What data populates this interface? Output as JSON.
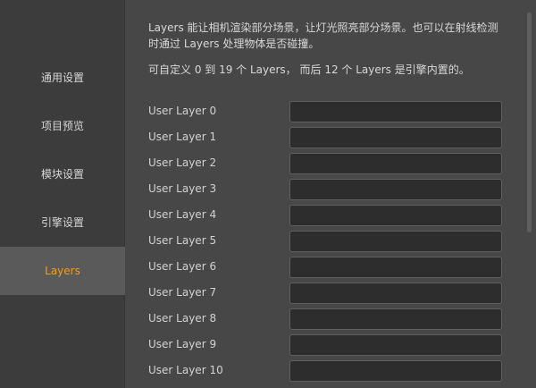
{
  "sidebar": {
    "items": [
      {
        "label": "通用设置",
        "active": false
      },
      {
        "label": "项目预览",
        "active": false
      },
      {
        "label": "模块设置",
        "active": false
      },
      {
        "label": "引擎设置",
        "active": false
      },
      {
        "label": "Layers",
        "active": true
      }
    ]
  },
  "main": {
    "description_line1": "Layers 能让相机渲染部分场景，让灯光照亮部分场景。也可以在射线检测",
    "description_line2": "时通过 Layers 处理物体是否碰撞。",
    "description_line3": "可自定义 0 到 19 个 Layers， 而后 12 个 Layers 是引擎内置的。",
    "layers": [
      {
        "label": "User Layer 0",
        "value": ""
      },
      {
        "label": "User Layer 1",
        "value": ""
      },
      {
        "label": "User Layer 2",
        "value": ""
      },
      {
        "label": "User Layer 3",
        "value": ""
      },
      {
        "label": "User Layer 4",
        "value": ""
      },
      {
        "label": "User Layer 5",
        "value": ""
      },
      {
        "label": "User Layer 6",
        "value": ""
      },
      {
        "label": "User Layer 7",
        "value": ""
      },
      {
        "label": "User Layer 8",
        "value": ""
      },
      {
        "label": "User Layer 9",
        "value": ""
      },
      {
        "label": "User Layer 10",
        "value": ""
      }
    ]
  },
  "colors": {
    "accent": "#f0a012",
    "panel_bg": "#474747",
    "sidebar_bg": "#3c3c3c",
    "active_bg": "#5a5a5a",
    "input_bg": "#2d2d2d"
  }
}
